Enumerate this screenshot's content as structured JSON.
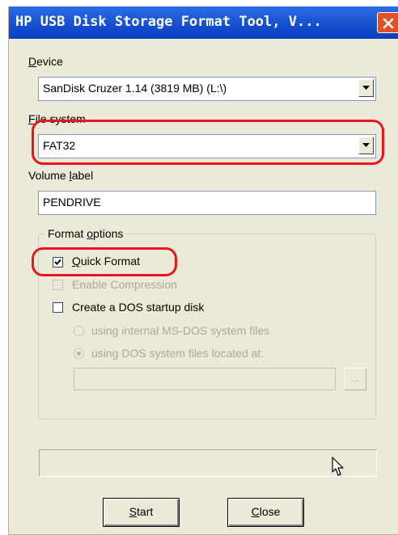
{
  "window": {
    "title": "HP USB Disk Storage Format Tool, V...",
    "close_glyph": "close-icon"
  },
  "device": {
    "label_accel": "D",
    "label_rest": "evice",
    "selected": "SanDisk Cruzer 1.14 (3819 MB) (L:\\)"
  },
  "file_system": {
    "label_accel": "F",
    "label_rest": "ile system",
    "selected": "FAT32"
  },
  "volume_label": {
    "label_pre": "Volume ",
    "label_accel": "l",
    "label_rest": "abel",
    "value": "PENDRIVE"
  },
  "format_options": {
    "legend_pre": "Format ",
    "legend_accel": "o",
    "legend_rest": "ptions",
    "quick_format": {
      "label_accel": "Q",
      "label_rest": "uick Format",
      "checked": true
    },
    "enable_compression": {
      "label": "Enable Compression",
      "checked": false,
      "enabled": false
    },
    "dos_startup": {
      "label": "Create a DOS startup disk",
      "checked": false
    },
    "radio_internal": {
      "label": "using internal MS-DOS system files",
      "selected": false,
      "enabled": false
    },
    "radio_located": {
      "label": "using DOS system files located at:",
      "selected": true,
      "enabled": false
    },
    "path_value": "",
    "browse_label": "..."
  },
  "buttons": {
    "start_accel": "S",
    "start_rest": "tart",
    "close_accel": "C",
    "close_rest": "lose"
  },
  "colors": {
    "highlight": "#e4171c",
    "titlebar": "#1c58d4",
    "dialog_bg": "#ece9d8"
  }
}
